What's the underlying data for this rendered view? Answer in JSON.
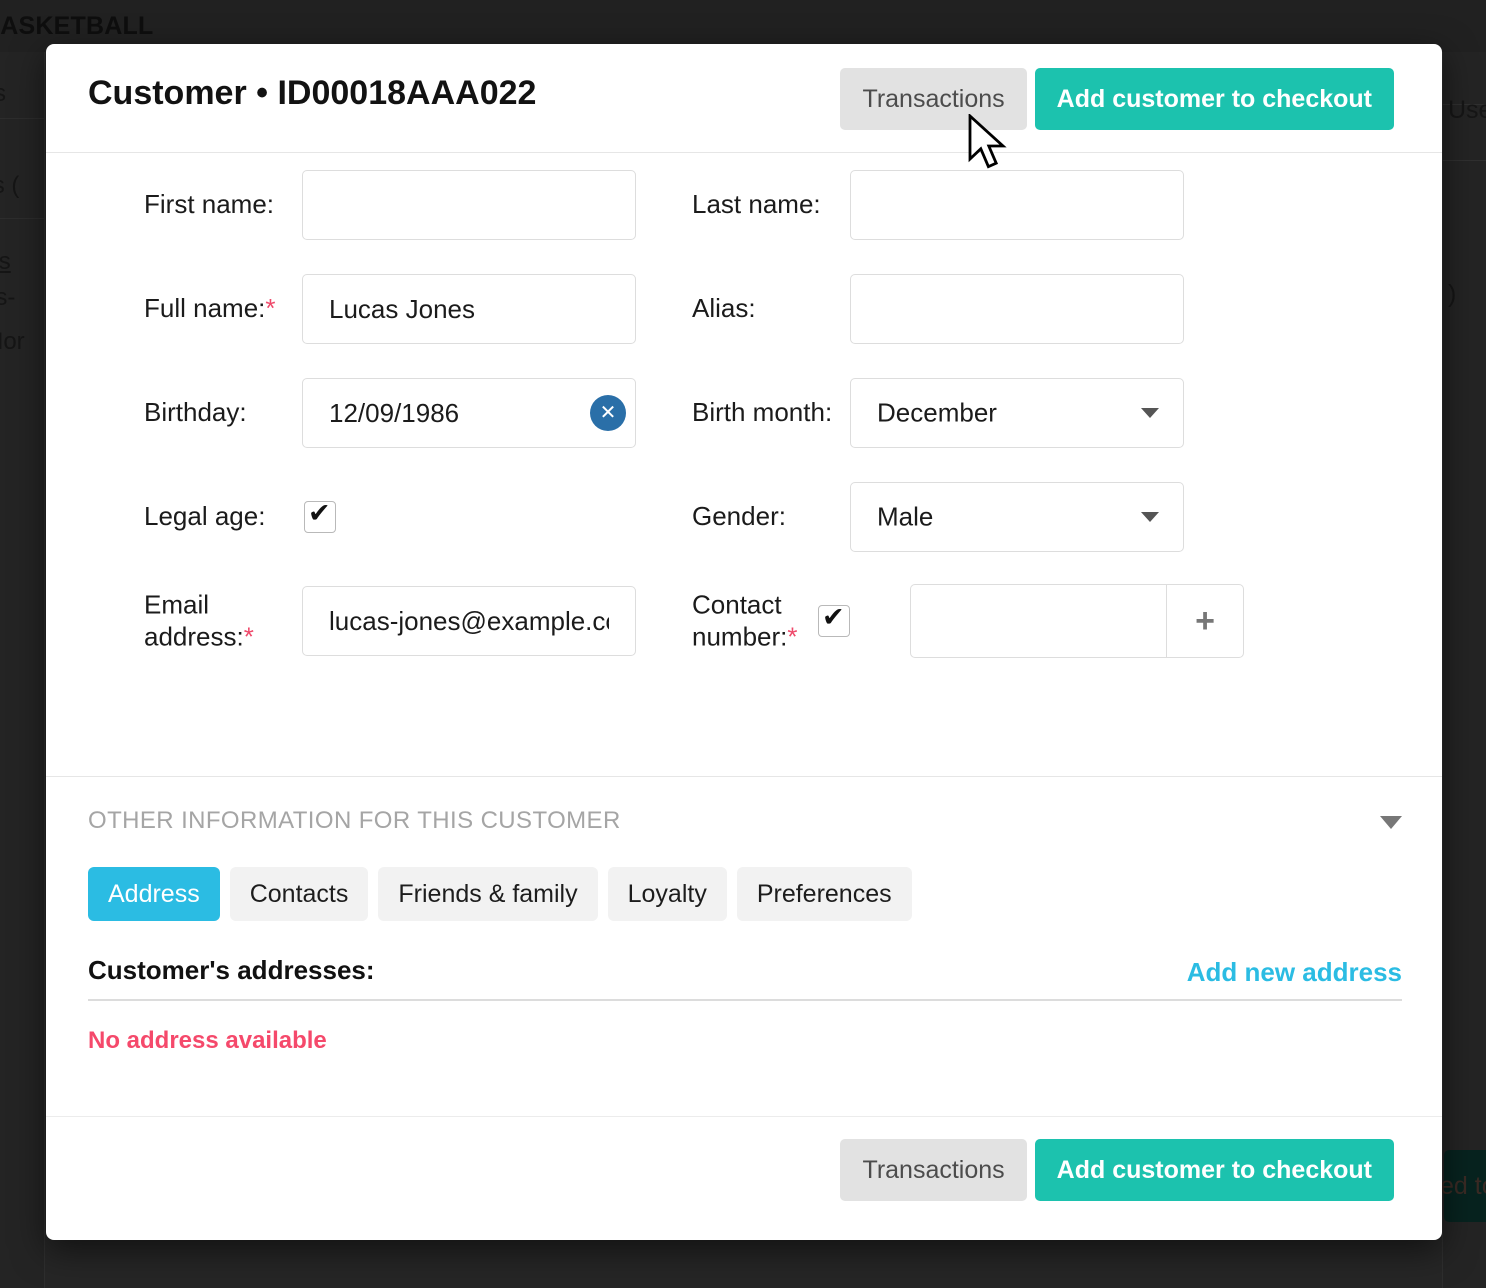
{
  "background": {
    "topbar_title": "BASKETBALL",
    "fragments": [
      "s",
      "ons (",
      "nes",
      "cas-",
      "Nor",
      "Use",
      ")",
      "ed to"
    ]
  },
  "modal": {
    "header": {
      "title": "Customer • ID00018AAA022",
      "transactions_label": "Transactions",
      "checkout_label": "Add customer to checkout"
    },
    "form": {
      "left": [
        {
          "label": "First name:",
          "required": false,
          "type": "text",
          "value": "",
          "placeholder": ""
        },
        {
          "label": "Full name:",
          "required": true,
          "type": "text",
          "value": "Lucas Jones",
          "placeholder": ""
        },
        {
          "label": "Birthday:",
          "required": false,
          "type": "text-clear",
          "value": "12/09/1986",
          "placeholder": "",
          "clear_icon": "close-circle-icon"
        },
        {
          "label": "Legal age:",
          "required": false,
          "type": "checkbox",
          "checked": true
        },
        {
          "label": "Email address:",
          "required": true,
          "type": "text",
          "value": "lucas-jones@example.com",
          "placeholder": ""
        }
      ],
      "right": [
        {
          "label": "Last name:",
          "required": false,
          "type": "text",
          "value": "",
          "placeholder": ""
        },
        {
          "label": "Alias:",
          "required": false,
          "type": "text",
          "value": "",
          "placeholder": ""
        },
        {
          "label": "Birth month:",
          "required": false,
          "type": "select",
          "value": "December"
        },
        {
          "label": "Gender:",
          "required": false,
          "type": "select",
          "value": "Male"
        },
        {
          "label": "Contact number:",
          "required": true,
          "type": "checkbox-input-add",
          "checked": true,
          "value": "",
          "placeholder": "",
          "add_label": "+"
        }
      ]
    },
    "other": {
      "title": "OTHER INFORMATION FOR THIS CUSTOMER",
      "toggle_icon": "chevron-down-icon",
      "tabs": [
        {
          "label": "Address",
          "active": true
        },
        {
          "label": "Contacts",
          "active": false
        },
        {
          "label": "Friends & family",
          "active": false
        },
        {
          "label": "Loyalty",
          "active": false
        },
        {
          "label": "Preferences",
          "active": false
        }
      ],
      "addresses_heading": "Customer's addresses:",
      "add_address_label": "Add new address",
      "empty_message": "No address available"
    },
    "footer": {
      "transactions_label": "Transactions",
      "checkout_label": "Add customer to checkout"
    }
  },
  "colors": {
    "primary_teal": "#1cc2ae",
    "tab_blue": "#2bbce3",
    "required_red": "#ef4a6b",
    "empty_red": "#f5496b",
    "clear_blue": "#2a6fa8",
    "secondary_grey": "#e2e2e2"
  }
}
